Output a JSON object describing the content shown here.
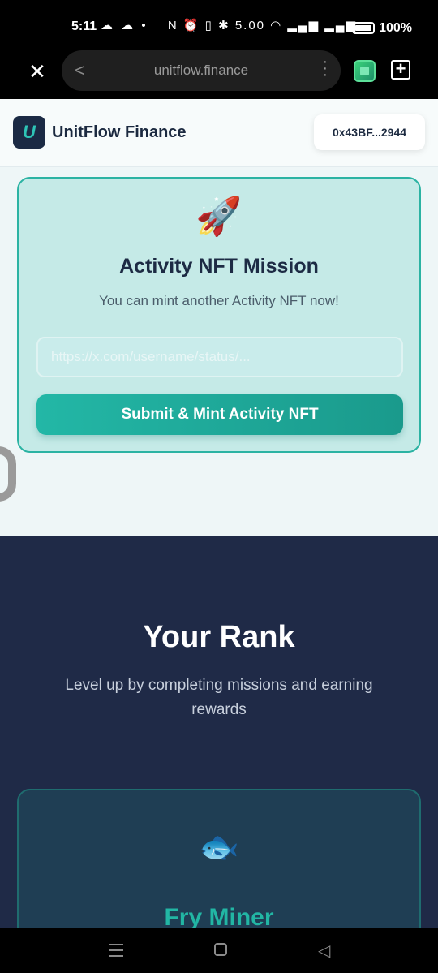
{
  "status_bar": {
    "time": "5:11",
    "left_icons": "☁ ☁  •",
    "right_icons": "N ⏰ ▯ ✱ 5.00 ◠ ▂▄▆ ▂▄▆",
    "battery": "100%"
  },
  "browser": {
    "url": "unitflow.finance",
    "close_icon": "close-icon",
    "back_icon": "chevron-left-icon",
    "menu_icon": "more-vert-icon",
    "new_tab_icon": "plus-box-icon"
  },
  "header": {
    "brand": "UnitFlow Finance",
    "wallet": "0x43BF...2944"
  },
  "mission": {
    "icon": "🚀",
    "title": "Activity NFT Mission",
    "subtitle": "You can mint another Activity NFT now!",
    "input_placeholder": "https://x.com/username/status/...",
    "button_label": "Submit & Mint Activity NFT"
  },
  "rank": {
    "title": "Your Rank",
    "subtitle": "Level up by completing missions and earning rewards",
    "card": {
      "icon": "🐟",
      "name": "Fry Miner"
    }
  },
  "colors": {
    "accent": "#22b6a4",
    "dark_bg": "#1f2a47",
    "card_bg": "#c5eae7"
  }
}
